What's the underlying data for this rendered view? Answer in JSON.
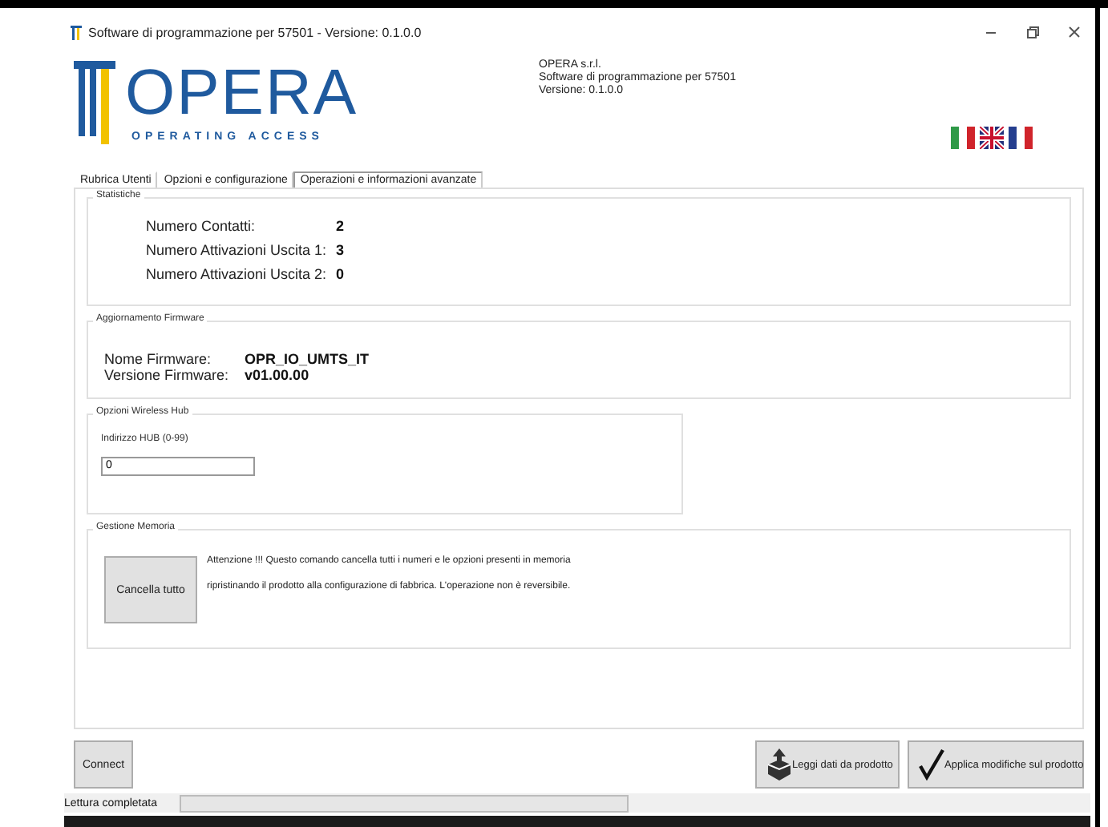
{
  "window": {
    "title": "Software di programmazione per 57501  - Versione: 0.1.0.0"
  },
  "logo": {
    "name": "OPERA",
    "tagline": "OPERATING ACCESS"
  },
  "info": [
    "OPERA s.r.l.",
    "Software di programmazione per 57501",
    "Versione: 0.1.0.0"
  ],
  "flags": [
    {
      "kind": "italy"
    },
    {
      "kind": "uk"
    },
    {
      "kind": "france"
    }
  ],
  "tabs": [
    {
      "label": "Rubrica Utenti",
      "selected": false
    },
    {
      "label": "Opzioni e configurazione",
      "selected": false
    },
    {
      "label": "Operazioni e informazioni avanzate",
      "selected": true
    }
  ],
  "statistics": {
    "title": "Statistiche",
    "rows": [
      {
        "label": "Numero Contatti:",
        "value": "2"
      },
      {
        "label": "Numero Attivazioni Uscita 1:",
        "value": "3"
      },
      {
        "label": "Numero Attivazioni Uscita 2:",
        "value": "0"
      }
    ]
  },
  "firmware": {
    "title": "Aggiornamento Firmware",
    "rows": [
      {
        "label": "Nome Firmware:",
        "value": "OPR_IO_UMTS_IT"
      },
      {
        "label": "Versione Firmware:",
        "value": "v01.00.00"
      }
    ]
  },
  "hub": {
    "title": "Opzioni Wireless Hub",
    "field_label": "Indirizzo HUB (0-99)",
    "value": "0"
  },
  "memory": {
    "title": "Gestione Memoria",
    "button": "Cancella tutto",
    "warning": [
      "Attenzione !!! Questo comando cancella tutti i numeri e le opzioni presenti in memoria",
      "ripristinando il prodotto alla configurazione di fabbrica. L'operazione non è reversibile."
    ]
  },
  "footer": {
    "connect": "Connect",
    "actions": [
      {
        "kind": "read",
        "label": "Leggi dati da prodotto"
      },
      {
        "kind": "apply",
        "label": "Applica modifiche sul prodotto"
      }
    ]
  },
  "status_bar": {
    "text": "Lettura completata",
    "progress": {
      "level": 0
    }
  }
}
